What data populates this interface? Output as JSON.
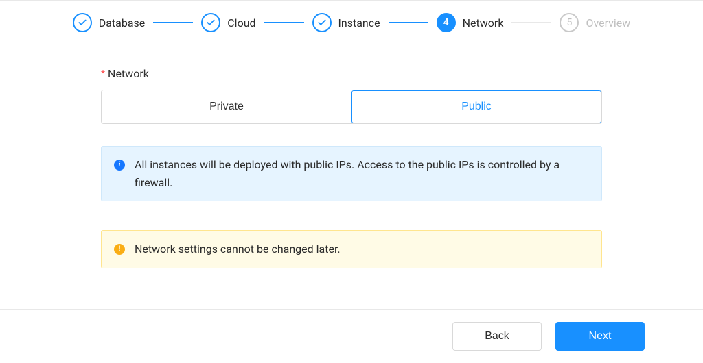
{
  "stepper": {
    "steps": [
      {
        "label": "Database",
        "state": "done"
      },
      {
        "label": "Cloud",
        "state": "done"
      },
      {
        "label": "Instance",
        "state": "done"
      },
      {
        "label": "Network",
        "state": "active",
        "num": "4"
      },
      {
        "label": "Overview",
        "state": "future",
        "num": "5"
      }
    ]
  },
  "form": {
    "required_mark": "*",
    "label": "Network",
    "options": {
      "private": "Private",
      "public": "Public"
    },
    "selected_option": "public"
  },
  "alerts": {
    "info_text": "All instances will be deployed with public IPs. Access to the public IPs is controlled by a firewall.",
    "warn_text": "Network settings cannot be changed later."
  },
  "footer": {
    "back": "Back",
    "next": "Next"
  },
  "colors": {
    "primary": "#1890ff",
    "warning": "#faad14",
    "border": "#e8e8e8"
  }
}
